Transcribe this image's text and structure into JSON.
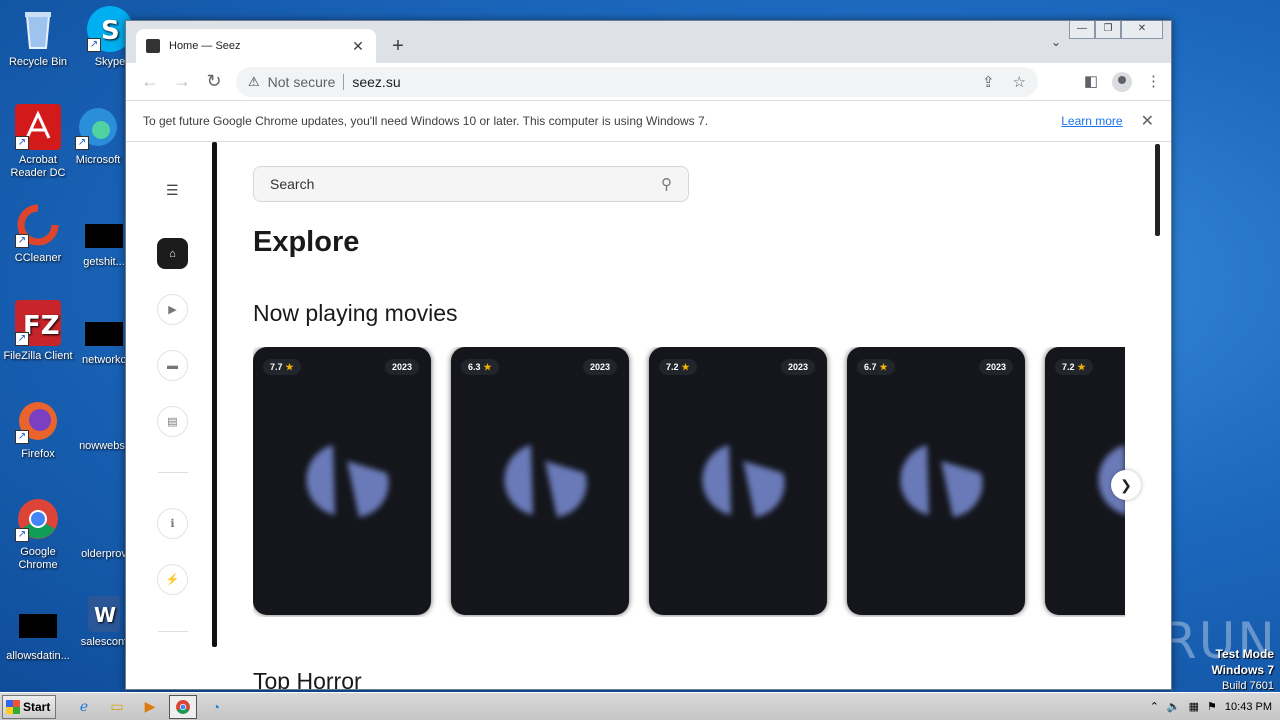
{
  "desktop": {
    "icons": [
      {
        "label": "Recycle Bin",
        "icon": "recycle-bin-icon",
        "color": "#7fb0e8"
      },
      {
        "label": "Skype",
        "icon": "skype-icon",
        "color": "#00aff0"
      },
      {
        "label": "Acrobat Reader DC",
        "icon": "acrobat-icon",
        "color": "#d31a1a"
      },
      {
        "label": "Microsoft",
        "icon": "edge-icon",
        "color": "#2a8fd8"
      },
      {
        "label": "CCleaner",
        "icon": "ccleaner-icon",
        "color": "#e0452b"
      },
      {
        "label": "getshit...",
        "icon": "black-file-icon",
        "color": "#000000"
      },
      {
        "label": "FileZilla Client",
        "icon": "filezilla-icon",
        "color": "#c8242b"
      },
      {
        "label": "networkc",
        "icon": "black-file-icon",
        "color": "#000000"
      },
      {
        "label": "Firefox",
        "icon": "firefox-icon",
        "color": "#e8642a"
      },
      {
        "label": "nowwebs",
        "icon": "blank-file-icon",
        "color": "#1d6ac0"
      },
      {
        "label": "Google Chrome",
        "icon": "chrome-icon",
        "color": "#3a8f3a"
      },
      {
        "label": "olderprov",
        "icon": "blank-file-icon",
        "color": "#1d6ac0"
      },
      {
        "label": "allowsdatin...",
        "icon": "black-file-icon",
        "color": "#000000"
      },
      {
        "label": "salescont",
        "icon": "word-icon",
        "color": "#2b5797"
      }
    ],
    "watermark": "ANY RUN",
    "testmode": {
      "line1": "Test Mode",
      "line2": "Windows 7",
      "line3": "Build 7601"
    }
  },
  "browser": {
    "tab_title": "Home — Seez",
    "address": {
      "security": "Not secure",
      "url": "seez.su"
    },
    "infobar": {
      "message": "To get future Google Chrome updates, you'll need Windows 10 or later. This computer is using Windows 7.",
      "link": "Learn more"
    }
  },
  "page": {
    "search_placeholder": "Search",
    "heading": "Explore",
    "section1": "Now playing movies",
    "section2": "Top Horror",
    "movies": [
      {
        "rating": "7.7",
        "year": "2023"
      },
      {
        "rating": "6.3",
        "year": "2023"
      },
      {
        "rating": "7.2",
        "year": "2023"
      },
      {
        "rating": "6.7",
        "year": "2023"
      },
      {
        "rating": "7.2",
        "year": ""
      }
    ],
    "sidebar": [
      "menu-icon",
      "home-icon",
      "play-icon",
      "tv-icon",
      "archive-icon",
      "info-icon",
      "bolt-icon"
    ]
  },
  "taskbar": {
    "start": "Start",
    "clock": "10:43 PM"
  }
}
